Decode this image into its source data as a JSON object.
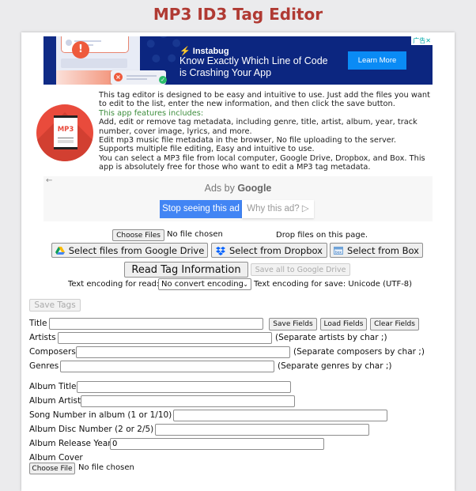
{
  "header": {
    "title": "MP3 ID3 Tag Editor"
  },
  "banner_ad": {
    "brand": "Instabug",
    "headline_line1": "Know Exactly Which Line of Code",
    "headline_line2": "is Crashing Your App",
    "cta": "Learn More",
    "choices": "广告✕"
  },
  "intro": {
    "icon_label": "MP3",
    "p1": "This tag editor is designed to be easy and intuitive to use. Just add the files you want to edit to the list, enter the new information, and then click the save button.",
    "features_heading": "This app features includes:",
    "features": [
      "Add, edit or remove tag metadata, including genre, title, artist, album, year, track number, cover image, lyrics, and more.",
      "Edit mp3 music file metadata in the browser, No file uploading to the server.",
      "Supports multiple file editing, Easy and intuitive to use.",
      "You can select a MP3 file from local computer, Google Drive, Dropbox, and Box. This app is absolutely free for those who want to edit a MP3 tag metadata."
    ]
  },
  "google_ads": {
    "back": "←",
    "ads_by": "Ads by",
    "google": "Google",
    "stop": "Stop seeing this ad",
    "why": "Why this ad? ▷"
  },
  "file_controls": {
    "choose_files": "Choose Files",
    "no_file": "No file chosen",
    "drop_hint": "Drop files on this page.",
    "google_drive": "Select files from Google Drive",
    "dropbox": "Select from Dropbox",
    "box": "Select from Box",
    "read_tags": "Read Tag Information",
    "save_all_drive": "Save all to Google Drive",
    "read_encoding_label": "Text encoding for read:",
    "read_encoding_value": "No convert encoding",
    "save_encoding_label": "Text encoding for save: Unicode (UTF-8)"
  },
  "form": {
    "save_tags": "Save Tags",
    "save_fields": "Save Fields",
    "load_fields": "Load Fields",
    "clear_fields": "Clear Fields",
    "title_label": "Title",
    "title_value": "",
    "artists_label": "Artists",
    "artists_value": "",
    "artists_hint": "(Separate artists by char ;)",
    "composers_label": "Composers",
    "composers_value": "",
    "composers_hint": "(Separate composers by char ;)",
    "genres_label": "Genres",
    "genres_value": "",
    "genres_hint": "(Separate genres by char ;)",
    "album_title_label": "Album Title",
    "album_title_value": "",
    "album_artist_label": "Album Artist",
    "album_artist_value": "",
    "song_number_label": "Song Number in album (1 or 1/10)",
    "song_number_value": "",
    "disc_number_label": "Album Disc Number (2 or 2/5)",
    "disc_number_value": "",
    "release_year_label": "Album Release Year",
    "release_year_value": "0",
    "cover_label": "Album Cover",
    "cover_choose": "Choose File",
    "cover_no_file": "No file chosen"
  }
}
